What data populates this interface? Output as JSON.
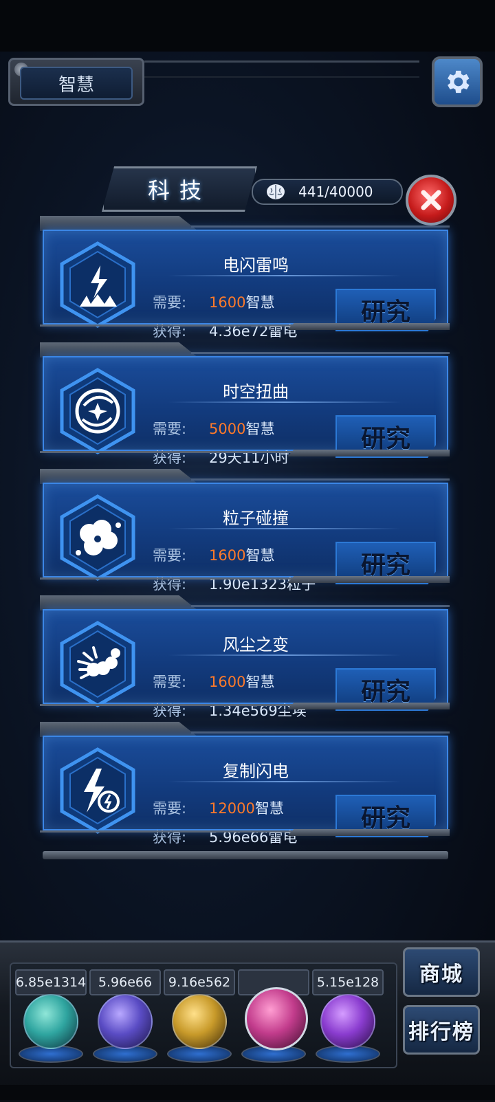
{
  "header": {
    "resource_tab": "智慧",
    "settings_icon": "gear-icon"
  },
  "panel": {
    "title": "科技",
    "counter": "441/40000",
    "counter_icon": "brain-icon",
    "close_icon": "close-icon"
  },
  "techs": [
    {
      "name": "电闪雷鸣",
      "icon": "lightning-burst-icon",
      "need_label": "需要:",
      "need_value": "1600",
      "need_unit": "智慧",
      "gain_label": "获得:",
      "gain": "4.36e72雷电",
      "button": "研究"
    },
    {
      "name": "时空扭曲",
      "icon": "vortex-icon",
      "need_label": "需要:",
      "need_value": "5000",
      "need_unit": "智慧",
      "gain_label": "获得:",
      "gain": "29天11小时",
      "button": "研究"
    },
    {
      "name": "粒子碰撞",
      "icon": "particle-collision-icon",
      "need_label": "需要:",
      "need_value": "1600",
      "need_unit": "智慧",
      "gain_label": "获得:",
      "gain": "1.90e1323粒子",
      "button": "研究"
    },
    {
      "name": "风尘之变",
      "icon": "dust-storm-icon",
      "need_label": "需要:",
      "need_value": "1600",
      "need_unit": "智慧",
      "gain_label": "获得:",
      "gain": "1.34e569尘埃",
      "button": "研究"
    },
    {
      "name": "复制闪电",
      "icon": "copy-lightning-icon",
      "need_label": "需要:",
      "need_value": "12000",
      "need_unit": "智慧",
      "gain_label": "获得:",
      "gain": "5.96e66雷电",
      "button": "研究"
    }
  ],
  "resources": [
    {
      "label": "6.85e1314",
      "color": "#2fa5a0"
    },
    {
      "label": "5.96e66",
      "color": "#5a4cc4"
    },
    {
      "label": "9.16e562",
      "color": "#c89a2a"
    },
    {
      "label": "",
      "color": "#c23c8c"
    },
    {
      "label": "5.15e128",
      "color": "#8a3ccf"
    }
  ],
  "side_buttons": {
    "shop": "商城",
    "ranking": "排行榜"
  },
  "colors": {
    "cost": "#ff7a2a",
    "card_blue": "#1a4c9a",
    "close_red": "#c51b1b"
  }
}
